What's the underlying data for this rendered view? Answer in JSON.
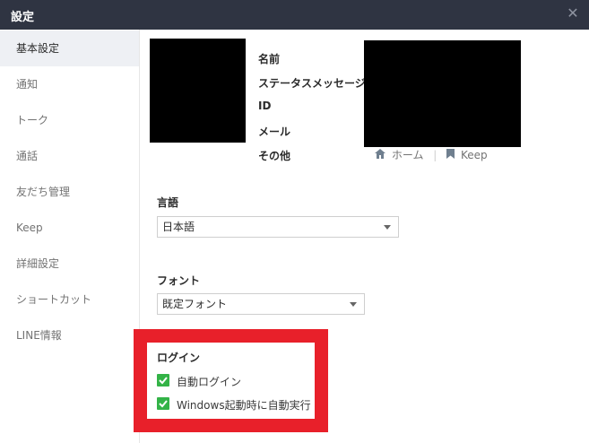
{
  "window": {
    "title": "設定",
    "close_glyph": "✕"
  },
  "sidebar": {
    "items": [
      {
        "label": "基本設定",
        "active": true
      },
      {
        "label": "通知"
      },
      {
        "label": "トーク"
      },
      {
        "label": "通話"
      },
      {
        "label": "友だち管理"
      },
      {
        "label": "Keep"
      },
      {
        "label": "詳細設定"
      },
      {
        "label": "ショートカット"
      },
      {
        "label": "LINE情報"
      }
    ]
  },
  "profile": {
    "labels": [
      "名前",
      "ステータスメッセージ",
      "ID",
      "メール",
      "その他"
    ],
    "links": {
      "home": "ホーム",
      "keep": "Keep"
    }
  },
  "language": {
    "label": "言語",
    "value": "日本語"
  },
  "font": {
    "label": "フォント",
    "value": "既定フォント"
  },
  "login": {
    "title": "ログイン",
    "options": [
      {
        "label": "自動ログイン",
        "checked": true
      },
      {
        "label": "Windows起動時に自動実行",
        "checked": true
      }
    ]
  },
  "colors": {
    "titlebar": "#2f3442",
    "highlight": "#e8202a",
    "checkbox": "#33b347"
  },
  "icons": {
    "close": "close-icon",
    "home": "home-icon",
    "keep": "bookmark-icon",
    "dropdown": "chevron-down-icon",
    "check": "check-icon"
  }
}
